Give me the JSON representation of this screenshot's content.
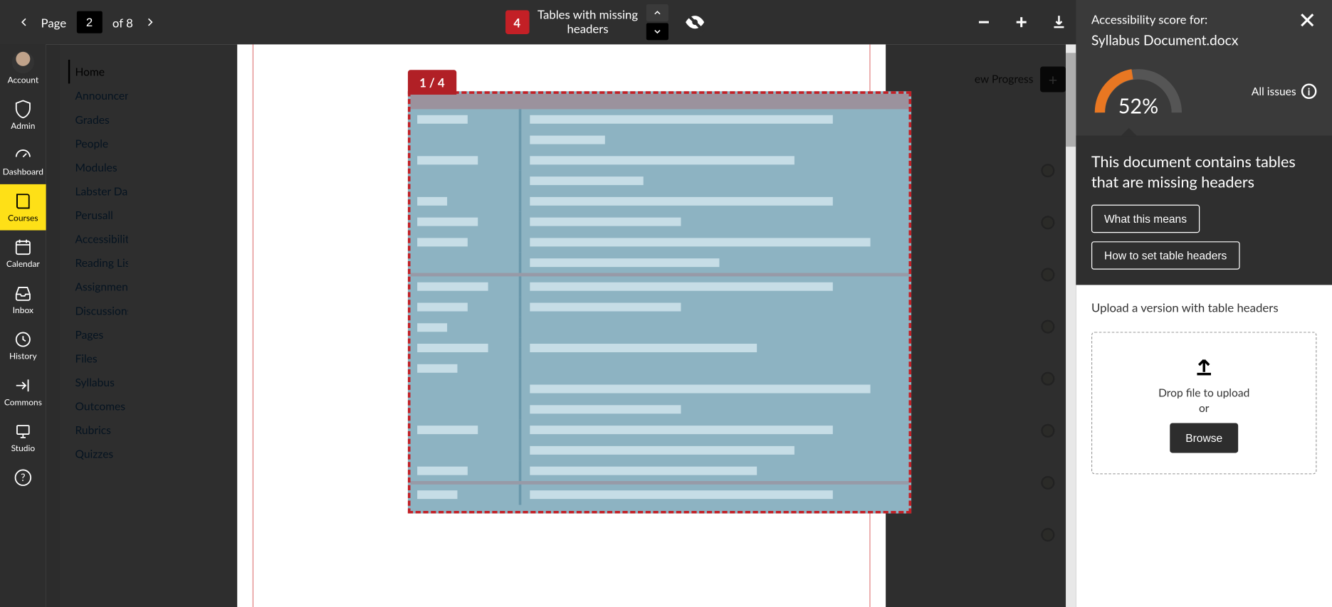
{
  "globalNav": {
    "items": [
      {
        "label": "Account",
        "icon": "avatar"
      },
      {
        "label": "Admin",
        "icon": "shield"
      },
      {
        "label": "Dashboard",
        "icon": "speedometer"
      },
      {
        "label": "Courses",
        "icon": "book",
        "active": true
      },
      {
        "label": "Calendar",
        "icon": "calendar"
      },
      {
        "label": "Inbox",
        "icon": "inbox"
      },
      {
        "label": "History",
        "icon": "clock"
      },
      {
        "label": "Commons",
        "icon": "share"
      },
      {
        "label": "Studio",
        "icon": "studio"
      }
    ]
  },
  "courseNav": {
    "items": [
      "Home",
      "Announcements",
      "Grades",
      "People",
      "Modules",
      "Labster Dashboard",
      "Perusall",
      "Accessibility Report",
      "Reading List",
      "Assignments",
      "Discussions",
      "Pages",
      "Files",
      "Syllabus",
      "Outcomes",
      "Rubrics",
      "Quizzes"
    ]
  },
  "toolbar": {
    "page_label": "Page",
    "current_page": "2",
    "of_label": "of",
    "total_pages": "8",
    "issue_count": "4",
    "issue_title_line1": "Tables with missing",
    "issue_title_line2": "headers"
  },
  "docPreview": {
    "issue_badge": "1 / 4"
  },
  "coursePageBg": {
    "progress_label": "ew Progress"
  },
  "rightPanel": {
    "title": "Accessibility score for:",
    "filename": "Syllabus Document.docx",
    "score": "52%",
    "all_issues_label": "All issues",
    "issue_description": "This document contains tables that are missing headers",
    "what_btn": "What this means",
    "how_btn": "How to set table headers",
    "upload_title": "Upload a version with table headers",
    "drop_text": "Drop file to upload",
    "or_text": "or",
    "browse_btn": "Browse"
  }
}
